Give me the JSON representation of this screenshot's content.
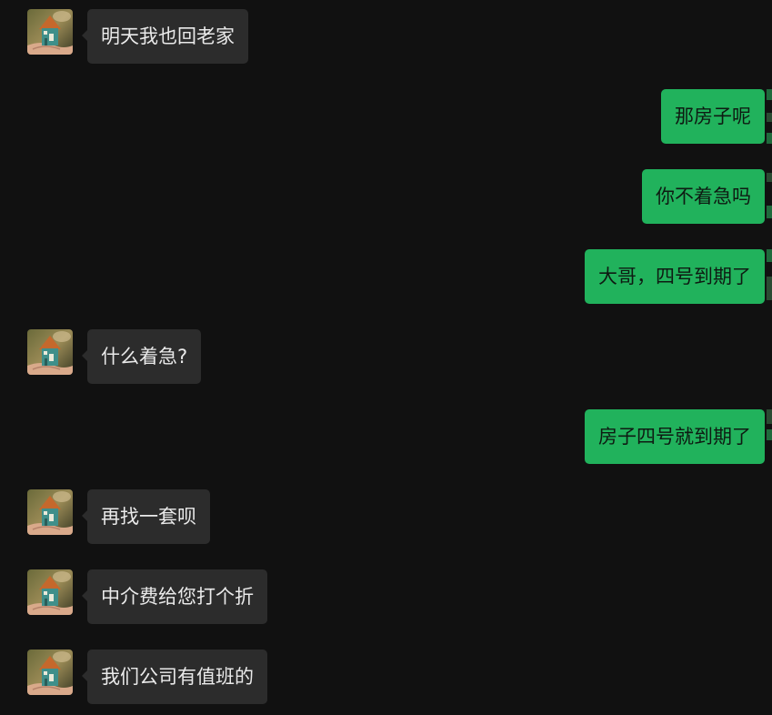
{
  "chat": {
    "messages": [
      {
        "side": "left",
        "text": "明天我也回老家"
      },
      {
        "side": "right",
        "text": "那房子呢"
      },
      {
        "side": "right",
        "text": "你不着急吗"
      },
      {
        "side": "right",
        "text": "大哥，四号到期了"
      },
      {
        "side": "left",
        "text": "什么着急?"
      },
      {
        "side": "right",
        "text": "房子四号就到期了"
      },
      {
        "side": "left",
        "text": "再找一套呗"
      },
      {
        "side": "left",
        "text": "中介费给您打个折"
      },
      {
        "side": "left",
        "text": "我们公司有值班的"
      }
    ]
  },
  "icons": {
    "contact_avatar": "house-in-hand-avatar-icon"
  },
  "colors": {
    "background": "#111111",
    "incoming_bubble": "#2c2c2c",
    "outgoing_bubble": "#21b25c",
    "incoming_text": "#eaeaea",
    "outgoing_text": "#0e1a12"
  }
}
